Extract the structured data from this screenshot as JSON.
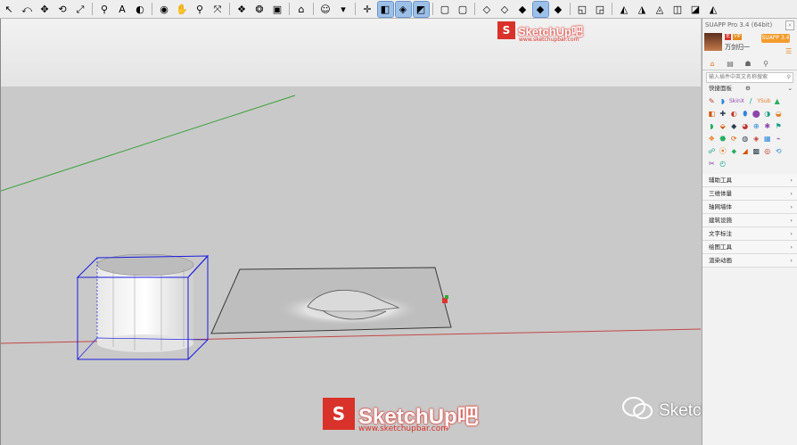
{
  "toolbar": {
    "groups": [
      [
        {
          "icon": "select-arrow-icon",
          "glyph": "↖"
        },
        {
          "icon": "lasso-icon",
          "glyph": "⤺"
        },
        {
          "icon": "move-icon",
          "glyph": "✥"
        },
        {
          "icon": "rotate-icon",
          "glyph": "⟲"
        },
        {
          "icon": "scale-icon",
          "glyph": "⤢"
        }
      ],
      [
        {
          "icon": "tape-measure-icon",
          "glyph": "⚲"
        },
        {
          "icon": "text-icon",
          "glyph": "A"
        },
        {
          "icon": "paint-bucket-icon",
          "glyph": "◐"
        }
      ],
      [
        {
          "icon": "orbit-icon",
          "glyph": "◉"
        },
        {
          "icon": "pan-icon",
          "glyph": "✋"
        },
        {
          "icon": "zoom-icon",
          "glyph": "⚲"
        },
        {
          "icon": "zoom-extents-icon",
          "glyph": "⤧"
        }
      ],
      [
        {
          "icon": "components-icon",
          "glyph": "❖"
        },
        {
          "icon": "materials-icon",
          "glyph": "❂"
        },
        {
          "icon": "styles-icon",
          "glyph": "▣"
        }
      ],
      [
        {
          "icon": "warehouse-icon",
          "glyph": "⌂"
        }
      ],
      [
        {
          "icon": "user-icon",
          "glyph": "☺"
        },
        {
          "icon": "dropdown-chevron-icon",
          "glyph": "▾"
        }
      ],
      [
        {
          "icon": "axes-icon",
          "glyph": "✛"
        },
        {
          "icon": "front-view-icon",
          "glyph": "◧",
          "active": true
        },
        {
          "icon": "iso-view-icon",
          "glyph": "◈",
          "active": true
        },
        {
          "icon": "top-view-icon",
          "glyph": "◩",
          "active": true
        }
      ],
      [
        {
          "icon": "xray-icon",
          "glyph": "▢"
        },
        {
          "icon": "back-edges-icon",
          "glyph": "▢"
        }
      ],
      [
        {
          "icon": "wireframe-icon",
          "glyph": "◇"
        },
        {
          "icon": "hidden-line-icon",
          "glyph": "◇"
        },
        {
          "icon": "shaded-icon",
          "glyph": "◆"
        },
        {
          "icon": "shaded-textures-icon",
          "glyph": "◆",
          "active": true
        },
        {
          "icon": "monochrome-icon",
          "glyph": "◆"
        }
      ],
      [
        {
          "icon": "push-pull-icon",
          "glyph": "◱"
        },
        {
          "icon": "follow-me-icon",
          "glyph": "◲"
        }
      ],
      [
        {
          "icon": "sandbox-contours-icon",
          "glyph": "◭"
        },
        {
          "icon": "sandbox-mesh-icon",
          "glyph": "◮"
        },
        {
          "icon": "smoove-icon",
          "glyph": "◬"
        },
        {
          "icon": "stamp-icon",
          "glyph": "◫"
        },
        {
          "icon": "drape-icon",
          "glyph": "◪"
        },
        {
          "icon": "add-detail-icon",
          "glyph": "◭"
        }
      ]
    ]
  },
  "watermark": {
    "brand": "SketchUp吧",
    "site": "www.sketchupbar.com",
    "logo_glyph": "S",
    "wechat_text": "SketchUp吧"
  },
  "viewport": {
    "background": "#c8c8c8",
    "sky": "#e9e9e9",
    "green_axis": "#3ca03c",
    "red_axis": "#c44848",
    "selection_color": "#1a1ae0"
  },
  "panel": {
    "title": "SUAPP Pro 3.4 (64bit)",
    "close_glyph": "×",
    "username": "万剑归一",
    "badge_a": "年",
    "badge_b": "VIP",
    "version_button": "SUAPP 3.4",
    "more_glyph": "☰",
    "tabs": [
      {
        "icon": "home-icon",
        "glyph": "⌂",
        "active": true
      },
      {
        "icon": "list-icon",
        "glyph": "▤"
      },
      {
        "icon": "person-icon",
        "glyph": "☗"
      },
      {
        "icon": "search-icon",
        "glyph": "⚲"
      }
    ],
    "search_placeholder": "输入插件中英文名称搜索",
    "quick_label": "快捷面板",
    "quick_gear": "⚙",
    "quick_chevron": "⌄",
    "plugin_icons": [
      "✎",
      "◗",
      "SkinX",
      "/",
      "YSub",
      "▲",
      "◧",
      "✚",
      "◐",
      "⬮",
      "⬤",
      "◑",
      "◒",
      "◗",
      "⬙",
      "◆",
      "◕",
      "⊕",
      "✱",
      "⚑",
      "❖",
      "⬣",
      "⟳",
      "◍",
      "◈",
      "▦",
      "⌁",
      "☍",
      "⦿",
      "⬥",
      "◢",
      "▩",
      "◎",
      "⟲",
      "✂",
      "◴"
    ],
    "categories": [
      "辅助工具",
      "三维体量",
      "轴网墙体",
      "建筑设施",
      "文字标注",
      "绘图工具",
      "渲染动画"
    ],
    "arrow_glyph": "›"
  }
}
